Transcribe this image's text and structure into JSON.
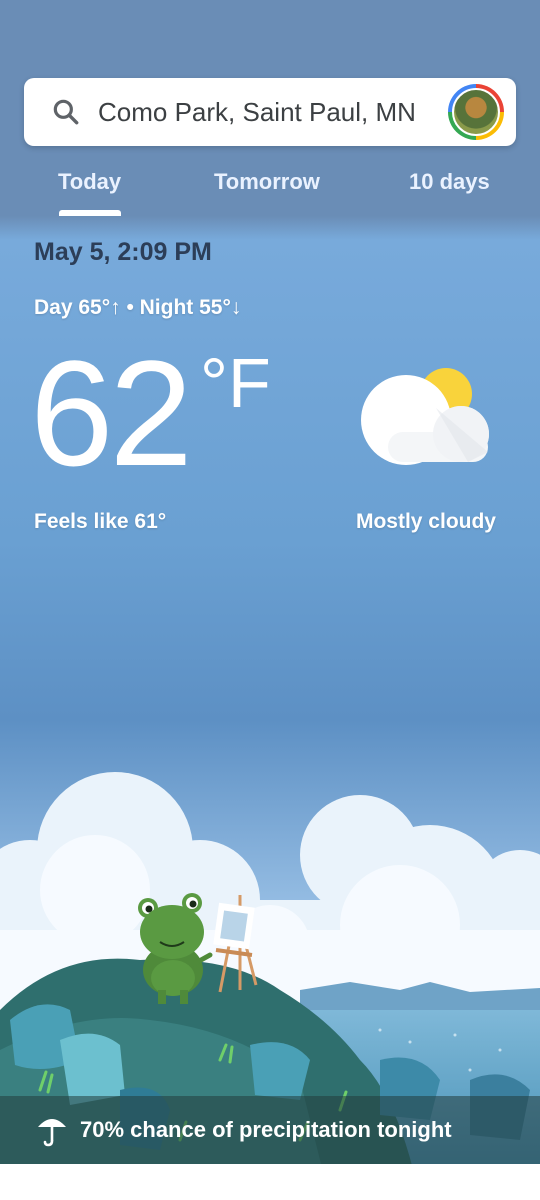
{
  "search": {
    "location": "Como Park, Saint Paul, MN"
  },
  "tabs": [
    {
      "label": "Today",
      "selected": true
    },
    {
      "label": "Tomorrow",
      "selected": false
    },
    {
      "label": "10 days",
      "selected": false
    }
  ],
  "current": {
    "datetime": "May 5, 2:09 PM",
    "day_night": "Day 65°↑ • Night 55°↓",
    "temperature": "62",
    "unit": "°F",
    "feels_like": "Feels like 61°",
    "condition": "Mostly cloudy",
    "condition_icon": "mostly-cloudy-icon"
  },
  "precipitation": {
    "text": "70% chance of precipitation tonight",
    "icon": "umbrella-icon"
  },
  "colors": {
    "header": "#6a8db6",
    "sky_top": "#78aadb",
    "sun": "#f9d33b"
  }
}
